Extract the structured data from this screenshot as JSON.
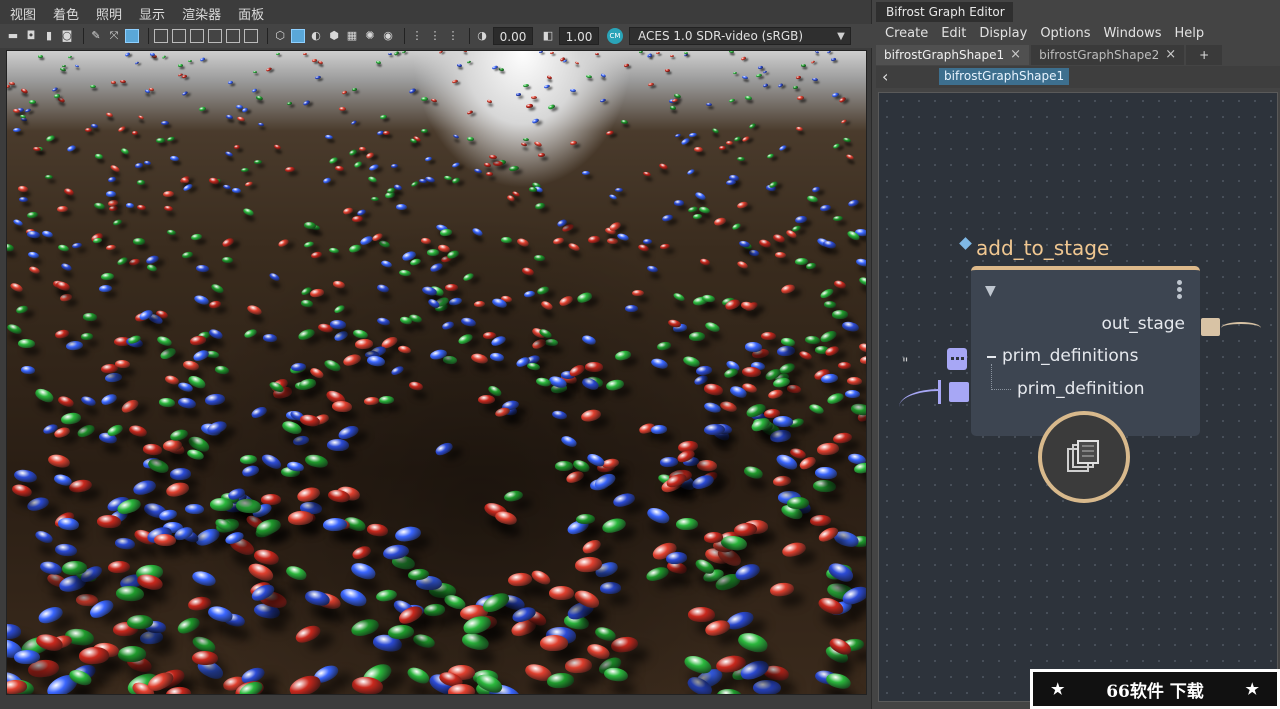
{
  "viewport": {
    "menu": [
      "视图",
      "着色",
      "照明",
      "显示",
      "渲染器",
      "面板"
    ],
    "toolbar": {
      "exposure": "0.00",
      "gamma": "1.00",
      "color_space": "ACES 1.0 SDR-video (sRGB)"
    }
  },
  "graph_editor": {
    "title": "Bifrost Graph Editor",
    "menu": [
      "Create",
      "Edit",
      "Display",
      "Options",
      "Windows",
      "Help"
    ],
    "tabs": [
      {
        "label": "bifrostGraphShape1",
        "close": "×"
      },
      {
        "label": "bifrostGraphShape2",
        "close": "×"
      }
    ],
    "add_tab": "+",
    "back": "‹",
    "breadcrumb": "bifrostGraphShape1",
    "node": {
      "name": "add_to_stage",
      "collapse": "▼",
      "ports": {
        "out_stage": "out_stage",
        "prim_definitions": "prim_definitions",
        "prim_definition": "prim_definition"
      },
      "quote": "\""
    }
  },
  "watermark": {
    "star_left": "★",
    "text": "66软件 下载",
    "star_right": "★"
  },
  "colors": {
    "node_accent": "#ddb98a",
    "port_purple": "#a7a7f5",
    "port_tan": "#d8c3a5",
    "crumb_blue": "#3d6f8e"
  }
}
